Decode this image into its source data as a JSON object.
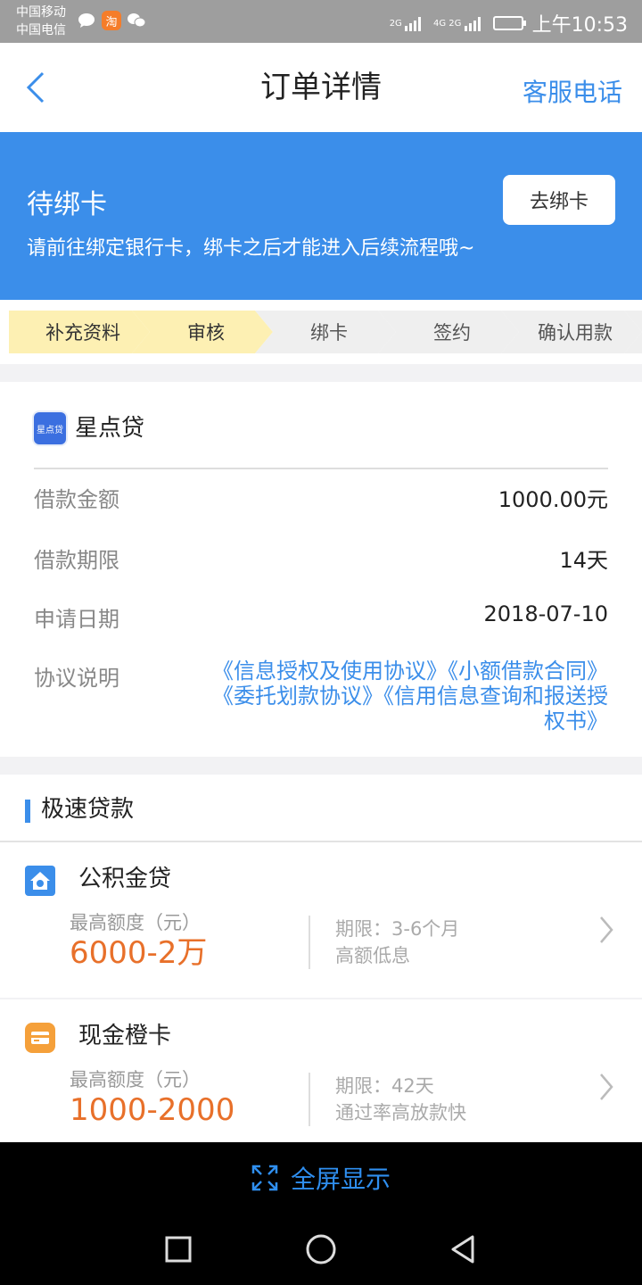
{
  "status_bar": {
    "carrier1": "中国移动",
    "carrier2": "中国电信",
    "net1": "2G",
    "net2": "4G 2G",
    "time": "上午10:53",
    "taobao_char": "淘"
  },
  "nav": {
    "title": "订单详情",
    "service_label": "客服电话"
  },
  "banner": {
    "title": "待绑卡",
    "description": "请前往绑定银行卡，绑卡之后才能进入后续流程哦~",
    "button_label": "去绑卡"
  },
  "steps": [
    {
      "label": "补充资料",
      "state": "done"
    },
    {
      "label": "审核",
      "state": "done"
    },
    {
      "label": "绑卡",
      "state": "todo"
    },
    {
      "label": "签约",
      "state": "todo"
    },
    {
      "label": "确认用款",
      "state": "todo"
    }
  ],
  "order": {
    "product_logo_text": "星点贷",
    "product_name": "星点贷",
    "rows": [
      {
        "label": "借款金额",
        "value": "1000.00元"
      },
      {
        "label": "借款期限",
        "value": "14天"
      },
      {
        "label": "申请日期",
        "value": "2018-07-10"
      }
    ],
    "agreement_label": "协议说明",
    "agreements": [
      "《信息授权及使用协议》",
      "《小额借款合同》",
      "《委托划款协议》",
      "《信用信息查询和报送授权书》"
    ]
  },
  "fast_loan": {
    "title": "极速贷款",
    "items": [
      {
        "name": "公积金贷",
        "max_label": "最高额度（元）",
        "amount": "6000-2万",
        "term": "期限：3-6个月",
        "feature": "高额低息",
        "icon": "house-icon"
      },
      {
        "name": "现金橙卡",
        "max_label": "最高额度（元）",
        "amount": "1000-2000",
        "term": "期限：42天",
        "feature": "通过率高放款快",
        "icon": "card-icon"
      }
    ]
  },
  "fullscreen_label": "全屏显示",
  "colors": {
    "accent": "#3b8eea",
    "amount": "#e8702a",
    "step_done": "#fdf0b3",
    "step_todo": "#efefef"
  }
}
